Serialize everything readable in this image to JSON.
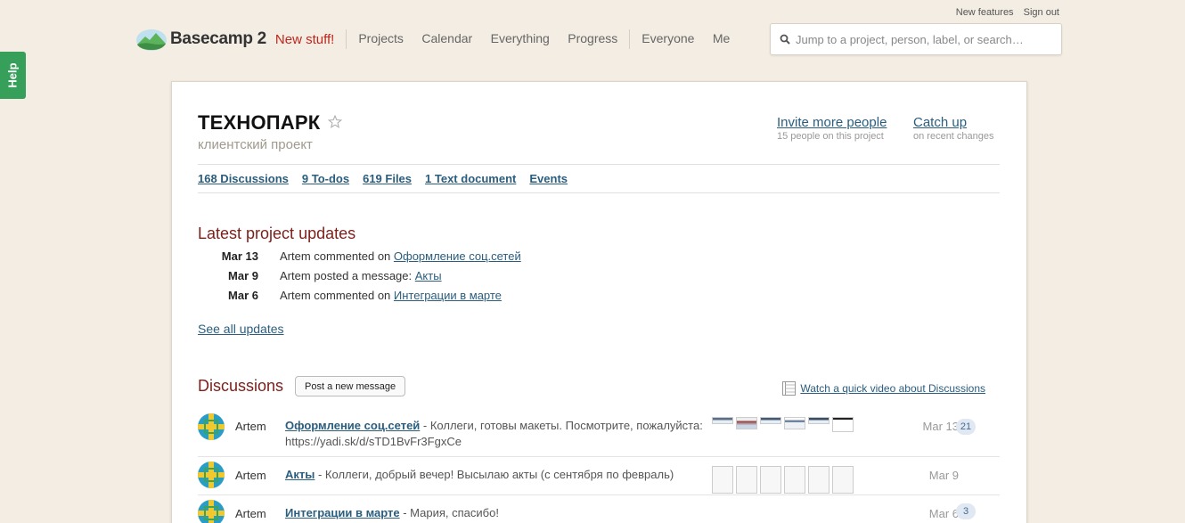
{
  "help": {
    "label": "Help"
  },
  "topright": {
    "new_features": "New features",
    "sign_out": "Sign out"
  },
  "header": {
    "logo_text": "Basecamp 2",
    "new_stuff": "New stuff!",
    "nav": [
      "Projects",
      "Calendar",
      "Everything",
      "Progress"
    ],
    "nav2": [
      "Everyone",
      "Me"
    ],
    "search_placeholder": "Jump to a project, person, label, or search…"
  },
  "project": {
    "title": "ТЕХНОПАРК",
    "subtitle": "клиентский проект",
    "invite": {
      "label": "Invite more people",
      "sub": "15 people on this project"
    },
    "catchup": {
      "label": "Catch up",
      "sub": "on recent changes"
    },
    "tabs": [
      "168 Discussions",
      "9 To-dos",
      "619 Files",
      "1 Text document",
      "Events"
    ]
  },
  "updates": {
    "title": "Latest project updates",
    "rows": [
      {
        "date": "Mar 13",
        "text": "Artem commented on ",
        "link": "Оформление соц.сетей"
      },
      {
        "date": "Mar 9",
        "text": "Artem posted a message: ",
        "link": "Акты"
      },
      {
        "date": "Mar 6",
        "text": "Artem commented on ",
        "link": "Интеграции в марте"
      }
    ],
    "see_all": "See all updates"
  },
  "discussions": {
    "title": "Discussions",
    "post_button": "Post a new message",
    "video_link": "Watch a quick video about Discussions",
    "rows": [
      {
        "author": "Artem",
        "title": "Оформление соц.сетей",
        "excerpt": " - Коллеги, готовы макеты. Посмотрите, пожалуйста: https://yadi.sk/d/sTD1BvFr3FgxCe",
        "date": "Mar 13",
        "count": "21"
      },
      {
        "author": "Artem",
        "title": "Акты",
        "excerpt": " - Коллеги, добрый вечер! Высылаю акты (с сентября по февраль)",
        "date": "Mar 9",
        "count": ""
      },
      {
        "author": "Artem",
        "title": "Интеграции в марте",
        "excerpt": " - Мария, спасибо!",
        "date": "Mar 6",
        "count": "3"
      }
    ]
  }
}
